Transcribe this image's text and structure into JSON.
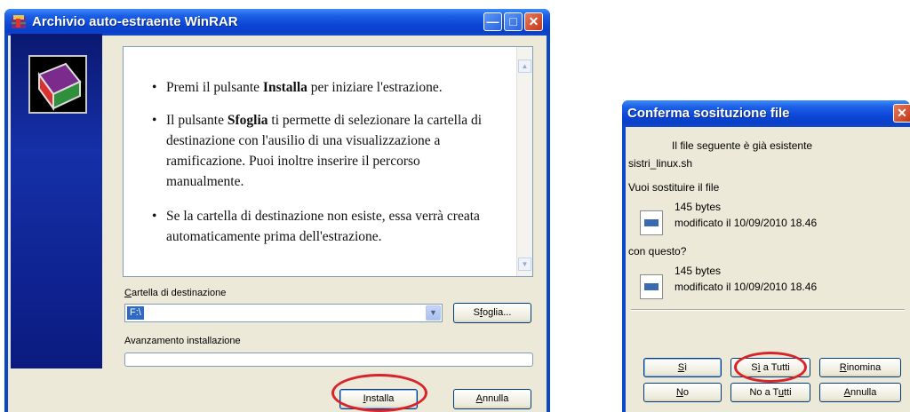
{
  "winrar": {
    "title": "Archivio auto-estraente WinRAR",
    "bullet1_pre": "Premi il pulsante ",
    "bullet1_bold": "Installa",
    "bullet1_post": " per iniziare l'estrazione.",
    "bullet2_pre": "Il pulsante ",
    "bullet2_bold": "Sfoglia",
    "bullet2_post": " ti permette di selezionare la cartella di destinazione con l'ausilio di una visualizzazione a ramificazione. Puoi inoltre inserire il percorso manualmente.",
    "bullet3": "Se la cartella di destinazione non esiste, essa verrà creata automaticamente prima dell'estrazione.",
    "dest_label_mnemonic": "C",
    "dest_label_rest": "artella di destinazione",
    "dest_value": "F:\\",
    "browse_mnemonic": "f",
    "browse_pre": "S",
    "browse_post": "oglia...",
    "progress_label": "Avanzamento installazione",
    "progress": 0,
    "install_mnemonic": "I",
    "install_rest": "nstalla",
    "cancel_mnemonic": "A",
    "cancel_rest": "nnulla"
  },
  "confirm": {
    "title": "Conferma sosituzione file",
    "exists_text": "Il file seguente è già esistente",
    "filename": "sistri_linux.sh",
    "replace_question": "Vuoi sostituire il file",
    "old_size": "145 bytes",
    "old_modified": "modificato il 10/09/2010 18.46",
    "with_this": "con questo?",
    "new_size": "145 bytes",
    "new_modified": "modificato il 10/09/2010 18.46",
    "btn_si_mnemonic": "S",
    "btn_si_rest": "ì",
    "btn_si_tutti_pre": "S",
    "btn_si_tutti_mnemonic": "ì",
    "btn_si_tutti_post": " a Tutti",
    "btn_rinomina_mnemonic": "R",
    "btn_rinomina_rest": "inomina",
    "btn_no_mnemonic": "N",
    "btn_no_rest": "o",
    "btn_no_tutti_pre": "No a T",
    "btn_no_tutti_mnemonic": "u",
    "btn_no_tutti_post": "tti",
    "btn_annulla_mnemonic": "A",
    "btn_annulla_rest": "nnulla"
  },
  "colors": {
    "title_bar": "#0a47c9",
    "highlight_ring": "#d8232a",
    "selection": "#316ac5"
  },
  "icons": [
    "winrar-logo-icon",
    "minimize-icon",
    "maximize-icon",
    "close-icon",
    "dropdown-arrow-icon",
    "file-icon"
  ]
}
